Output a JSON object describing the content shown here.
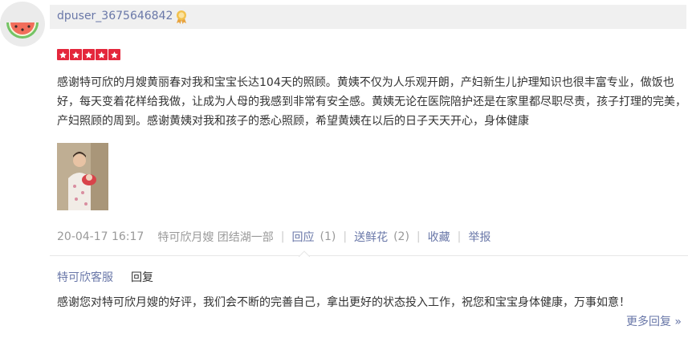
{
  "user": {
    "name": "dpuser_3675646842"
  },
  "rating": {
    "stars": 5,
    "max": 5
  },
  "review": {
    "text": "感谢特可欣的月嫂黄丽春对我和宝宝长达104天的照顾。黄姨不仅为人乐观开朗，产妇新生儿护理知识也很丰富专业，做饭也好，每天变着花样给我做，让成为人母的我感到非常有安全感。黄姨无论在医院陪护还是在家里都尽职尽责，孩子打理的完美，产妇照顾的周到。感谢黄姨对我和孩子的悉心照顾，希望黄姨在以后的日子天天开心，身体健康"
  },
  "meta": {
    "datetime": "20-04-17 16:17",
    "shop": "特可欣月嫂 团结湖一部",
    "separator": "|",
    "reply_label": "回应",
    "reply_count": "(1)",
    "flower_label": "送鲜花",
    "flower_count": "(2)",
    "favorite_label": "收藏",
    "report_label": "举报"
  },
  "shop_reply": {
    "author": "特可欣客服",
    "verb": "回复",
    "text": "感谢您对特可欣月嫂的好评，我们会不断的完善自己，拿出更好的状态投入工作，祝您和宝宝身体健康，万事如意！",
    "more_label": "更多回复 »"
  },
  "icons": {
    "avatar": "watermelon-icon",
    "medal": "medal-icon",
    "star": "star-icon"
  },
  "colors": {
    "link": "#6977a8",
    "star": "#e4273c",
    "text": "#333333",
    "muted": "#999999",
    "header_bg": "#f0f0f0"
  }
}
